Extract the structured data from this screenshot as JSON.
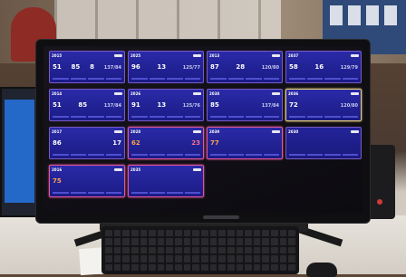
{
  "scene": {
    "main_monitor": "monitor with bedside vitals dashboard",
    "keyboard_color": "#151517",
    "accent_border": "#7a5ac8",
    "alert_border": "#e0569a",
    "warning_border": "#e8d07a"
  },
  "dashboard": {
    "cards": [
      {
        "bed": "2015",
        "vals": [
          "51",
          "85",
          "8",
          "137/84"
        ],
        "state": "normal",
        "col": 0,
        "row": 0
      },
      {
        "bed": "2025",
        "vals": [
          "96",
          "13",
          "125/77"
        ],
        "state": "normal",
        "col": 1,
        "row": 0
      },
      {
        "bed": "2013",
        "vals": [
          "87",
          "28",
          "120/80"
        ],
        "state": "normal",
        "col": 2,
        "row": 0
      },
      {
        "bed": "2037",
        "vals": [
          "58",
          "16",
          "129/79"
        ],
        "state": "normal",
        "col": 3,
        "row": 0
      },
      {
        "bed": "2014",
        "vals": [
          "51",
          "85",
          "137/84"
        ],
        "state": "normal",
        "col": 0,
        "row": 1
      },
      {
        "bed": "2026",
        "vals": [
          "91",
          "13",
          "125/76"
        ],
        "state": "normal",
        "col": 1,
        "row": 1
      },
      {
        "bed": "2038",
        "vals": [
          "85",
          "137/84"
        ],
        "state": "normal",
        "col": 2,
        "row": 1
      },
      {
        "bed": "2036",
        "vals": [
          "72",
          "120/80"
        ],
        "state": "warn",
        "col": 3,
        "row": 1
      },
      {
        "bed": "2017",
        "vals": [
          "86",
          "17"
        ],
        "state": "normal",
        "col": 0,
        "row": 2
      },
      {
        "bed": "2028",
        "vals": [
          "62",
          "23"
        ],
        "state": "alert",
        "col": 1,
        "row": 2
      },
      {
        "bed": "2039",
        "vals": [
          "77"
        ],
        "state": "alert",
        "col": 2,
        "row": 2
      },
      {
        "bed": "2030",
        "vals": [],
        "state": "blank",
        "col": 3,
        "row": 2
      },
      {
        "bed": "2016",
        "vals": [
          "75"
        ],
        "state": "alert",
        "col": 0,
        "row": 3
      },
      {
        "bed": "2035",
        "vals": [],
        "state": "alert",
        "col": 1,
        "row": 3
      }
    ]
  }
}
